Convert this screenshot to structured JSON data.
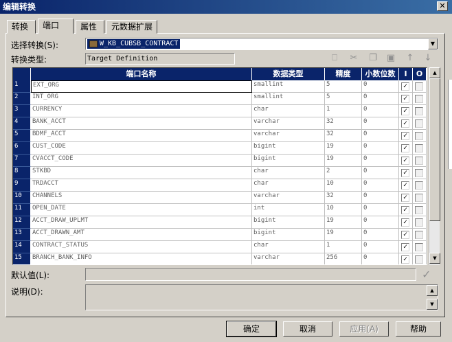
{
  "window": {
    "title": "编辑转换",
    "close_glyph": "✕"
  },
  "tabs": [
    {
      "label": "转换"
    },
    {
      "label": "端口"
    },
    {
      "label": "属性"
    },
    {
      "label": "元数据扩展"
    }
  ],
  "form": {
    "select_label": "选择转换(S):",
    "select_value": "W_KB_CUBSB_CONTRACT",
    "type_label": "转换类型:",
    "type_value": "Target Definition",
    "default_label": "默认值(L):",
    "desc_label": "说明(D):"
  },
  "toolbar": {
    "icons": [
      "new-port-icon",
      "cut-icon",
      "copy-icon",
      "paste-icon",
      "move-up-icon",
      "move-down-icon"
    ],
    "glyphs": [
      "⎕",
      "✂",
      "❐",
      "▣",
      "↑",
      "↓"
    ]
  },
  "grid": {
    "columns": [
      "端口名称",
      "数据类型",
      "精度",
      "小数位数",
      "I",
      "O"
    ],
    "rows": [
      {
        "n": "1",
        "name": "EXT_ORG",
        "type": "smallint",
        "precision": "5",
        "scale": "0",
        "i": true,
        "o": false
      },
      {
        "n": "2",
        "name": "INT_ORG",
        "type": "smallint",
        "precision": "5",
        "scale": "0",
        "i": true,
        "o": false
      },
      {
        "n": "3",
        "name": "CURRENCY",
        "type": "char",
        "precision": "1",
        "scale": "0",
        "i": true,
        "o": false
      },
      {
        "n": "4",
        "name": "BANK_ACCT",
        "type": "varchar",
        "precision": "32",
        "scale": "0",
        "i": true,
        "o": false
      },
      {
        "n": "5",
        "name": "BDMF_ACCT",
        "type": "varchar",
        "precision": "32",
        "scale": "0",
        "i": true,
        "o": false
      },
      {
        "n": "6",
        "name": "CUST_CODE",
        "type": "bigint",
        "precision": "19",
        "scale": "0",
        "i": true,
        "o": false
      },
      {
        "n": "7",
        "name": "CVACCT_CODE",
        "type": "bigint",
        "precision": "19",
        "scale": "0",
        "i": true,
        "o": false
      },
      {
        "n": "8",
        "name": "STKBD",
        "type": "char",
        "precision": "2",
        "scale": "0",
        "i": true,
        "o": false
      },
      {
        "n": "9",
        "name": "TRDACCT",
        "type": "char",
        "precision": "10",
        "scale": "0",
        "i": true,
        "o": false
      },
      {
        "n": "10",
        "name": "CHANNELS",
        "type": "varchar",
        "precision": "32",
        "scale": "0",
        "i": true,
        "o": false
      },
      {
        "n": "11",
        "name": "OPEN_DATE",
        "type": "int",
        "precision": "10",
        "scale": "0",
        "i": true,
        "o": false
      },
      {
        "n": "12",
        "name": "ACCT_DRAW_UPLMT",
        "type": "bigint",
        "precision": "19",
        "scale": "0",
        "i": true,
        "o": false
      },
      {
        "n": "13",
        "name": "ACCT_DRAWN_AMT",
        "type": "bigint",
        "precision": "19",
        "scale": "0",
        "i": true,
        "o": false
      },
      {
        "n": "14",
        "name": "CONTRACT_STATUS",
        "type": "char",
        "precision": "1",
        "scale": "0",
        "i": true,
        "o": false
      },
      {
        "n": "15",
        "name": "BRANCH_BANK_INFO",
        "type": "varchar",
        "precision": "256",
        "scale": "0",
        "i": true,
        "o": false
      }
    ]
  },
  "buttons": {
    "ok": "确定",
    "cancel": "取消",
    "apply": "应用(A)",
    "help": "帮助"
  },
  "colors": {
    "header_bg": "#0a246a",
    "dialog_bg": "#d4d0c8"
  }
}
